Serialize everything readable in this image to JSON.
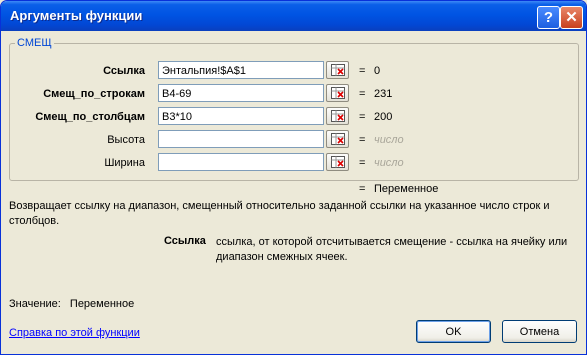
{
  "window": {
    "title": "Аргументы функции",
    "help_glyph": "?",
    "close_glyph": "✕"
  },
  "function": {
    "name": "СМЕЩ",
    "args": [
      {
        "label": "Ссылка",
        "bold": true,
        "value": "Энтальпия!$A$1",
        "eq": "=",
        "result": "0",
        "result_grey": false
      },
      {
        "label": "Смещ_по_строкам",
        "bold": true,
        "value": "B4-69",
        "eq": "=",
        "result": "231",
        "result_grey": false
      },
      {
        "label": "Смещ_по_столбцам",
        "bold": true,
        "value": "B3*10",
        "eq": "=",
        "result": "200",
        "result_grey": false
      },
      {
        "label": "Высота",
        "bold": false,
        "value": "",
        "eq": "=",
        "result": "число",
        "result_grey": true
      },
      {
        "label": "Ширина",
        "bold": false,
        "value": "",
        "eq": "=",
        "result": "число",
        "result_grey": true
      }
    ],
    "overall_eq": "=",
    "overall_result": "Переменное",
    "description": "Возвращает ссылку на диапазон, смещенный относительно заданной ссылки на указанное число строк и столбцов.",
    "current_arg_name": "Ссылка",
    "current_arg_desc": "ссылка, от которой отсчитывается смещение - ссылка на ячейку или диапазон смежных ячеек."
  },
  "value_label": "Значение:",
  "value_text": "Переменное",
  "help_link": "Справка по этой функции",
  "buttons": {
    "ok": "OK",
    "cancel": "Отмена"
  },
  "colors": {
    "titlebar": "#0054e3",
    "group_label": "#0046d5",
    "link": "#0000ff"
  }
}
